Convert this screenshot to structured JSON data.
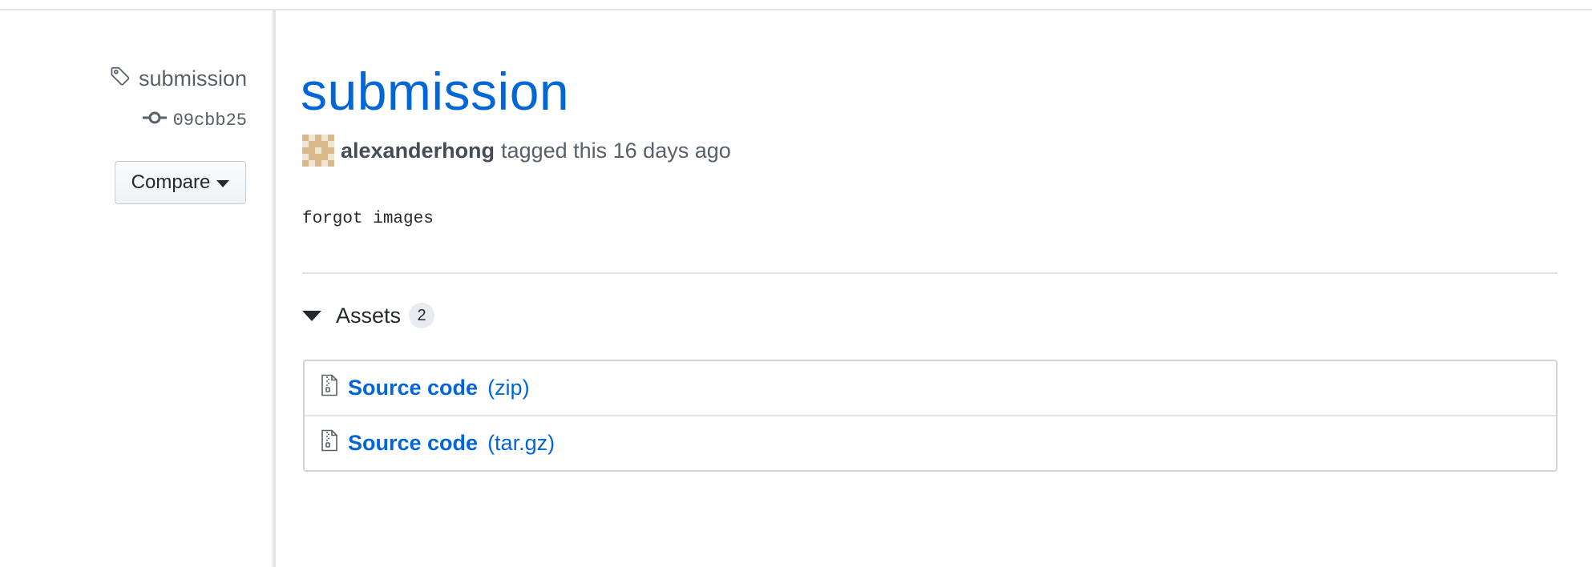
{
  "sidebar": {
    "tag_name": "submission",
    "commit_sha": "09cbb25",
    "compare_label": "Compare"
  },
  "release": {
    "title": "submission",
    "author": "alexanderhong",
    "tagged_text": "tagged this 16 days ago",
    "note": "forgot images"
  },
  "assets": {
    "label": "Assets",
    "count": "2",
    "items": [
      {
        "name": "Source code",
        "format": "(zip)",
        "icon": "file-zip-icon"
      },
      {
        "name": "Source code",
        "format": "(tar.gz)",
        "icon": "file-zip-icon"
      }
    ]
  },
  "colors": {
    "link": "#0366d6",
    "muted": "#586069",
    "border": "#e1e4e8",
    "avatar_primary": "#d9b98a",
    "avatar_background": "#f0e6d6"
  }
}
